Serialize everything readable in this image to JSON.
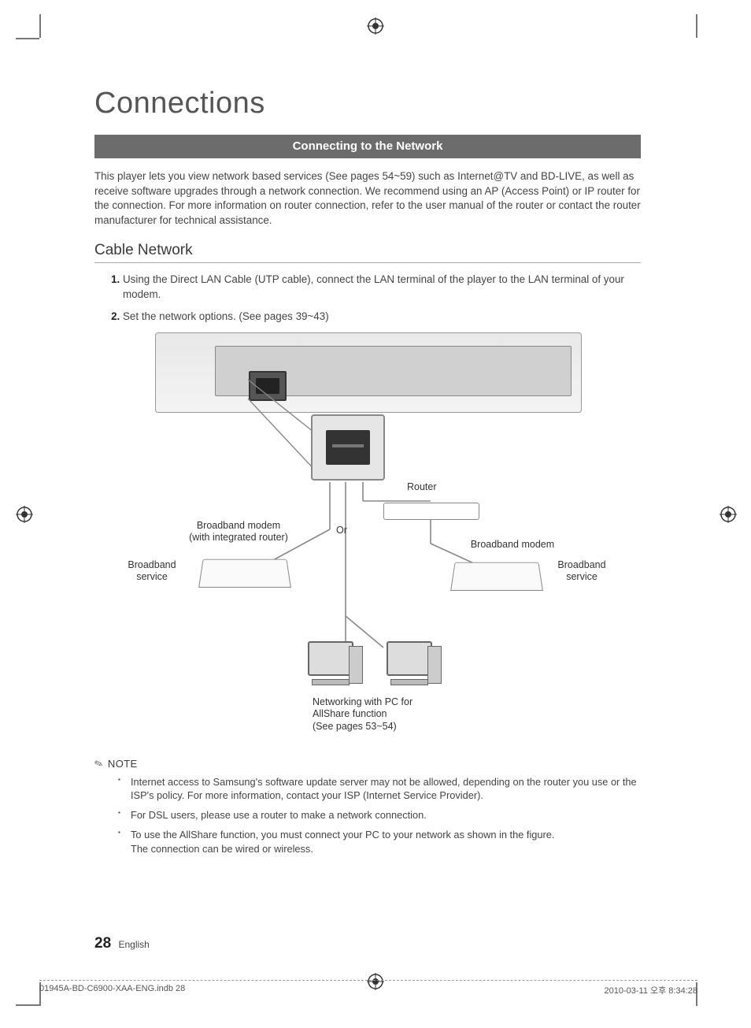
{
  "page_title": "Connections",
  "banner": "Connecting to the Network",
  "intro": "This player lets you view network based services (See pages 54~59) such as Internet@TV and BD-LIVE, as well as receive software upgrades through a network connection. We recommend using an AP (Access Point) or IP router for the connection. For more information on router connection, refer to the user manual of the router or contact the router manufacturer for technical assistance.",
  "subheading": "Cable Network",
  "steps": {
    "s1": "Using the Direct LAN Cable (UTP cable), connect the LAN terminal of the player to the LAN terminal of your modem.",
    "s2": "Set the network options. (See pages 39~43)"
  },
  "diagram": {
    "router": "Router",
    "or": "Or",
    "modem_left_l1": "Broadband modem",
    "modem_left_l2": "(with integrated router)",
    "modem_right": "Broadband modem",
    "service_left_l1": "Broadband",
    "service_left_l2": "service",
    "service_right_l1": "Broadband",
    "service_right_l2": "service",
    "pc_l1": "Networking with PC for",
    "pc_l2": "AllShare function",
    "pc_l3": "(See pages 53~54)"
  },
  "note_label": "NOTE",
  "notes": {
    "n1": "Internet access to Samsung's software update server may not be allowed, depending on the router you use or the ISP's policy. For more information, contact your ISP (Internet Service Provider).",
    "n2": "For DSL users, please use a router to make a network connection.",
    "n3a": "To use the AllShare function, you must connect your PC to your network as shown in the figure.",
    "n3b": "The connection can be wired or wireless."
  },
  "footer": {
    "page_num": "28",
    "lang": "English"
  },
  "print": {
    "left": "01945A-BD-C6900-XAA-ENG.indb   28",
    "right": "2010-03-11   오후 8:34:28"
  }
}
